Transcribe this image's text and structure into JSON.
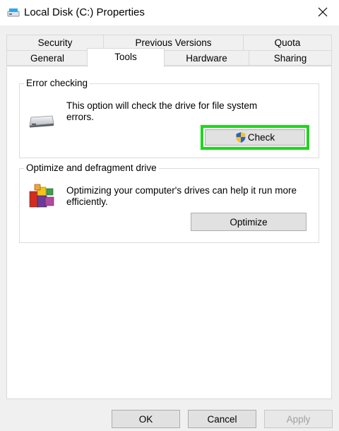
{
  "window": {
    "title": "Local Disk (C:) Properties",
    "icon": "drive-icon",
    "close_icon": "close-icon"
  },
  "tabs": {
    "row1": [
      {
        "label": "Security"
      },
      {
        "label": "Previous Versions"
      },
      {
        "label": "Quota"
      }
    ],
    "row2": [
      {
        "label": "General"
      },
      {
        "label": "Tools",
        "active": true
      },
      {
        "label": "Hardware"
      },
      {
        "label": "Sharing"
      }
    ]
  },
  "error_checking": {
    "group_label": "Error checking",
    "description": "This option will check the drive for file system errors.",
    "button_label": "Check",
    "icon": "hard-drive-icon",
    "button_icon": "uac-shield-icon",
    "highlight_color": "#21d41f"
  },
  "optimize": {
    "group_label": "Optimize and defragment drive",
    "description": "Optimizing your computer's drives can help it run more efficiently.",
    "button_label": "Optimize",
    "icon": "defrag-icon"
  },
  "footer": {
    "ok_label": "OK",
    "cancel_label": "Cancel",
    "apply_label": "Apply"
  }
}
